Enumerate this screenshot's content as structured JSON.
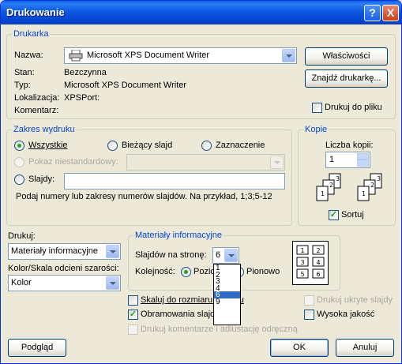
{
  "window": {
    "title": "Drukowanie"
  },
  "titlebar_buttons": {
    "help": "?",
    "close": "X"
  },
  "printer": {
    "group": "Drukarka",
    "name_label": "Nazwa:",
    "name_value": "Microsoft XPS Document Writer",
    "properties_button": "Właściwości",
    "find_button": "Znajdź drukarkę...",
    "status_label": "Stan:",
    "status_value": "Bezczynna",
    "type_label": "Typ:",
    "type_value": "Microsoft XPS Document Writer",
    "location_label": "Lokalizacja:",
    "location_value": "XPSPort:",
    "comment_label": "Komentarz:",
    "comment_value": "",
    "print_to_file": "Drukuj do pliku"
  },
  "range": {
    "group": "Zakres wydruku",
    "all": "Wszystkie",
    "current_slide": "Bieżący slajd",
    "selection": "Zaznaczenie",
    "custom_show": "Pokaz niestandardowy:",
    "slides": "Slajdy:",
    "slides_value": "",
    "hint": "Podaj numery lub zakresy numerów slajdów. Na przykład, 1;3;5-12"
  },
  "copies": {
    "group": "Kopie",
    "count_label": "Liczba kopii:",
    "count_value": "1",
    "collate": "Sortuj",
    "collate_icon_pages": [
      "1",
      "2",
      "3"
    ]
  },
  "print_what": {
    "label": "Drukuj:",
    "value": "Materiały informacyjne",
    "color_label": "Kolor/Skala odcieni szarości:",
    "color_value": "Kolor"
  },
  "handouts": {
    "group": "Materiały informacyjne",
    "slides_per_page_label": "Slajdów na stronę:",
    "slides_per_page_value": "6",
    "order_label": "Kolejność:",
    "horizontal": "Poziomo",
    "vertical": "Pionowo",
    "options": [
      "1",
      "2",
      "3",
      "4",
      "6",
      "9"
    ],
    "selected_option": "6",
    "preview_numbers": [
      "1",
      "2",
      "3",
      "4",
      "5",
      "6"
    ]
  },
  "options": {
    "scale_to_fit": "Skaluj do rozmiaru papieru",
    "frame_slides": "Obramowania slajdów",
    "print_comments": "Drukuj komentarze i adiustację odręczną",
    "print_hidden": "Drukuj ukryte slajdy",
    "high_quality": "Wysoka jakość"
  },
  "footer": {
    "preview": "Podgląd",
    "ok": "OK",
    "cancel": "Anuluj"
  }
}
